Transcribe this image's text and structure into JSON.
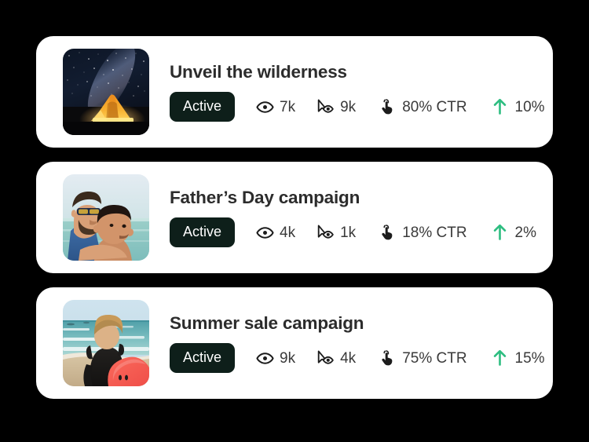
{
  "theme": {
    "background": "#000000",
    "card_background": "#ffffff",
    "badge_background": "#0e1f1a",
    "badge_text": "#ffffff",
    "title_color": "#2c2c2c",
    "metric_text": "#3a3a3a",
    "trend_accent": "#2dbd80"
  },
  "icons": {
    "impressions": "eye-icon",
    "views": "cursor-eye-icon",
    "clicks": "tap-hand-icon",
    "trend": "arrow-up-icon"
  },
  "cards": [
    {
      "title": "Unveil the wilderness",
      "status": "Active",
      "thumbnail_alt": "night-sky-tent-photo",
      "impressions": "7k",
      "views": "9k",
      "ctr": "80% CTR",
      "trend": "10%"
    },
    {
      "title": "Father’s Day campaign",
      "status": "Active",
      "thumbnail_alt": "father-and-son-beach-photo",
      "impressions": "4k",
      "views": "1k",
      "ctr": "18% CTR",
      "trend": "2%"
    },
    {
      "title": "Summer sale campaign",
      "status": "Active",
      "thumbnail_alt": "surfer-with-board-beach-photo",
      "impressions": "9k",
      "views": "4k",
      "ctr": "75% CTR",
      "trend": "15%"
    }
  ]
}
